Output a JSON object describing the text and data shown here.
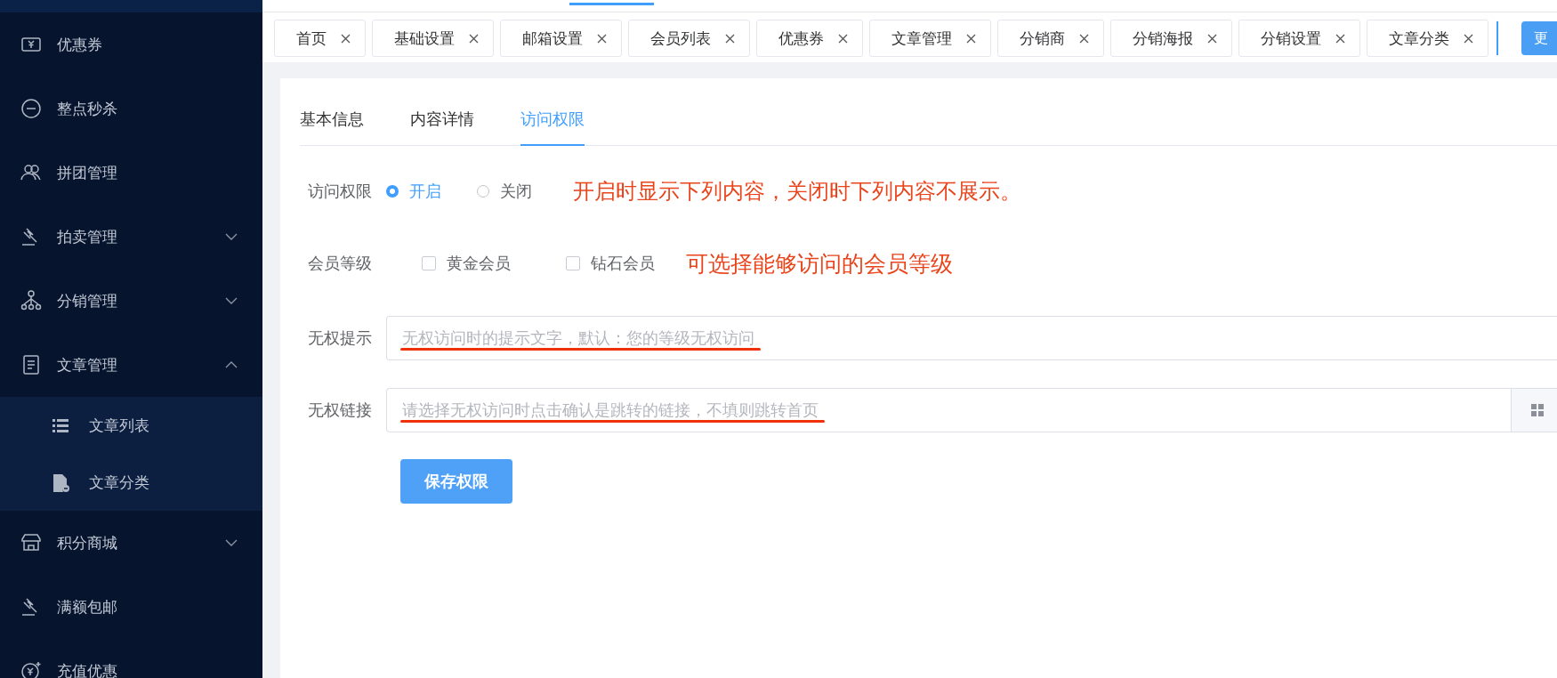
{
  "sidebar": {
    "items": [
      {
        "label": "优惠券"
      },
      {
        "label": "整点秒杀"
      },
      {
        "label": "拼团管理"
      },
      {
        "label": "拍卖管理",
        "expanded": false
      },
      {
        "label": "分销管理",
        "expanded": false
      },
      {
        "label": "文章管理",
        "expanded": true,
        "children": [
          {
            "label": "文章列表"
          },
          {
            "label": "文章分类"
          }
        ]
      },
      {
        "label": "积分商城",
        "expanded": false
      },
      {
        "label": "满额包邮"
      },
      {
        "label": "充值优惠"
      }
    ]
  },
  "tags": [
    {
      "label": "首页"
    },
    {
      "label": "基础设置"
    },
    {
      "label": "邮箱设置"
    },
    {
      "label": "会员列表"
    },
    {
      "label": "优惠券"
    },
    {
      "label": "文章管理"
    },
    {
      "label": "分销商"
    },
    {
      "label": "分销海报"
    },
    {
      "label": "分销设置"
    },
    {
      "label": "文章分类"
    }
  ],
  "more_button": {
    "label": "更"
  },
  "card": {
    "tabs": [
      {
        "label": "基本信息",
        "selected": false
      },
      {
        "label": "内容详情",
        "selected": false
      },
      {
        "label": "访问权限",
        "selected": true
      }
    ],
    "form": {
      "access": {
        "label": "访问权限",
        "options": [
          {
            "label": "开启",
            "selected": true
          },
          {
            "label": "关闭",
            "selected": false
          }
        ],
        "annotation": "开启时显示下列内容，关闭时下列内容不展示。"
      },
      "member_level": {
        "label": "会员等级",
        "options": [
          {
            "label": "黄金会员",
            "checked": false
          },
          {
            "label": "钻石会员",
            "checked": false
          }
        ],
        "annotation": "可选择能够访问的会员等级"
      },
      "fields": [
        {
          "label": "无权提示",
          "placeholder": "无权访问时的提示文字，默认：您的等级无权访问",
          "underlined": true
        },
        {
          "label": "无权链接",
          "placeholder": "请选择无权访问时点击确认是跳转的链接，不填则跳转首页",
          "underlined": true,
          "append": true
        }
      ],
      "save_button": "保存权限"
    }
  }
}
